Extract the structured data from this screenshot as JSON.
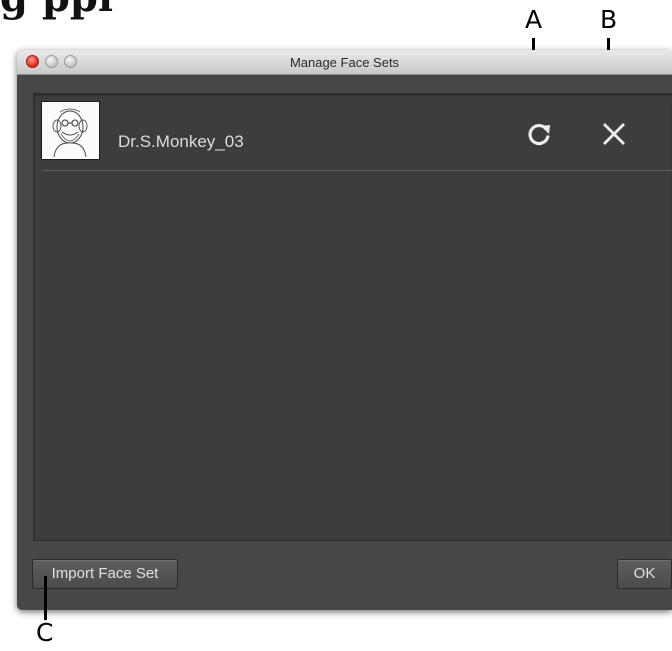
{
  "heading_fragment": "g ppl",
  "callouts": {
    "a": "A",
    "b": "B",
    "c": "C"
  },
  "window": {
    "title": "Manage Face Sets"
  },
  "face_sets": [
    {
      "name": "Dr.S.Monkey_03",
      "thumbnail_icon": "monkey-face-sketch",
      "reload_icon": "reload-icon",
      "delete_icon": "close-icon"
    }
  ],
  "footer": {
    "import_label": "Import Face Set",
    "ok_label": "OK"
  },
  "colors": {
    "window_bg": "#474747",
    "panel_bg": "#3d3d3d",
    "close_light": "#dd2418"
  }
}
